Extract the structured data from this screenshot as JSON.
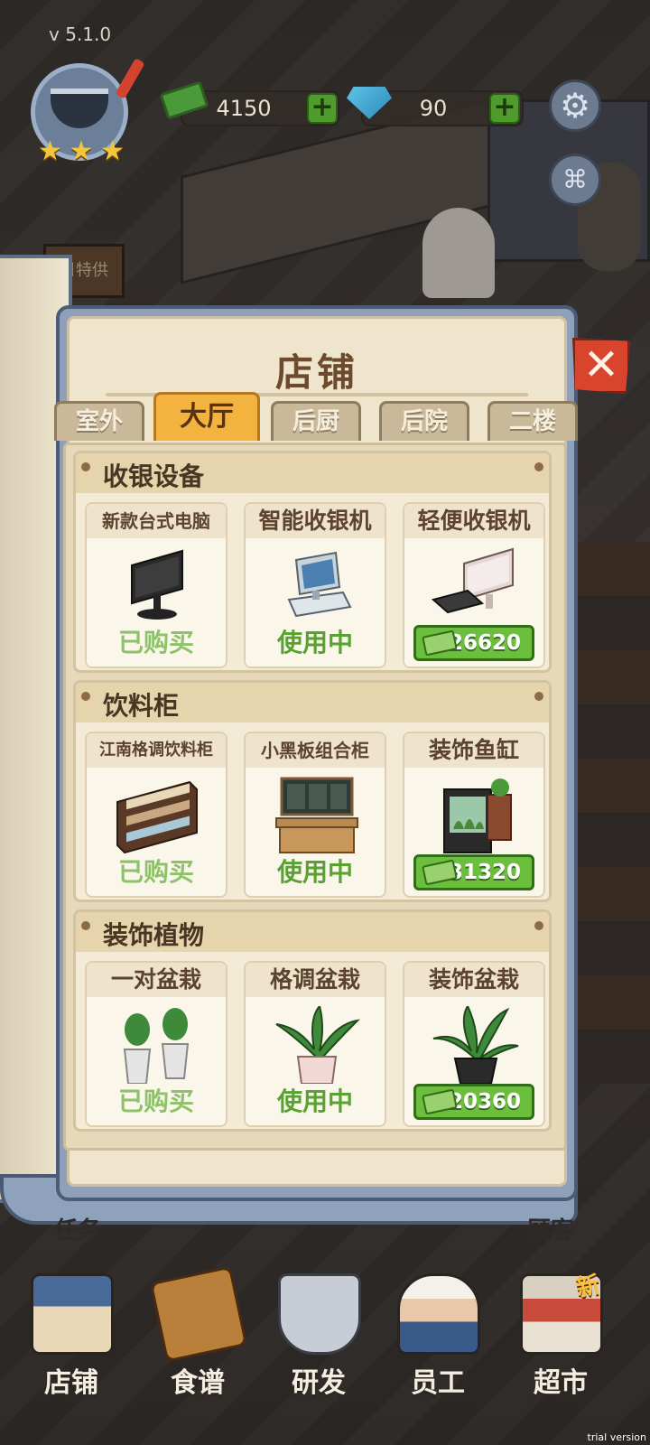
{
  "hud": {
    "version": "v  5.1.0",
    "cash": "4150",
    "gems": "90",
    "plus": "+",
    "gear_glyph": "⚙",
    "camera_glyph": "⌘",
    "stars": [
      "★",
      "★",
      "★"
    ]
  },
  "shop": {
    "title": "店铺",
    "close": "✕",
    "tabs": [
      "室外",
      "大厅",
      "后厨",
      "后院",
      "二楼"
    ],
    "active_tab": "大厅",
    "sections": [
      {
        "title": "收银设备",
        "items": [
          {
            "name": "新款台式电脑",
            "status": "已购买"
          },
          {
            "name": "智能收银机",
            "status": "使用中"
          },
          {
            "name": "轻便收银机",
            "price": "26620"
          }
        ]
      },
      {
        "title": "饮料柜",
        "items": [
          {
            "name": "江南格调饮料柜",
            "status": "已购买"
          },
          {
            "name": "小黑板组合柜",
            "status": "使用中"
          },
          {
            "name": "装饰鱼缸",
            "price": "31320"
          }
        ]
      },
      {
        "title": "装饰植物",
        "items": [
          {
            "name": "一对盆栽",
            "status": "已购买"
          },
          {
            "name": "格调盆栽",
            "status": "使用中"
          },
          {
            "name": "装饰盆栽",
            "price": "20360"
          }
        ]
      }
    ]
  },
  "bottom_nav": {
    "items": [
      "店铺",
      "食谱",
      "研发",
      "员工",
      "超市"
    ],
    "new_tag": "新"
  },
  "background": {
    "sign_text": "日特供",
    "left_label": "任务",
    "right_label": "顾客"
  },
  "watermark": "trial version",
  "colors": {
    "accent_tab": "#f3b33e",
    "status_bought": "#8dc26a",
    "status_in_use": "#58a232",
    "price_button": "#6cbf3c",
    "close_button": "#d9442c",
    "panel_frame": "#8ea0ba"
  }
}
